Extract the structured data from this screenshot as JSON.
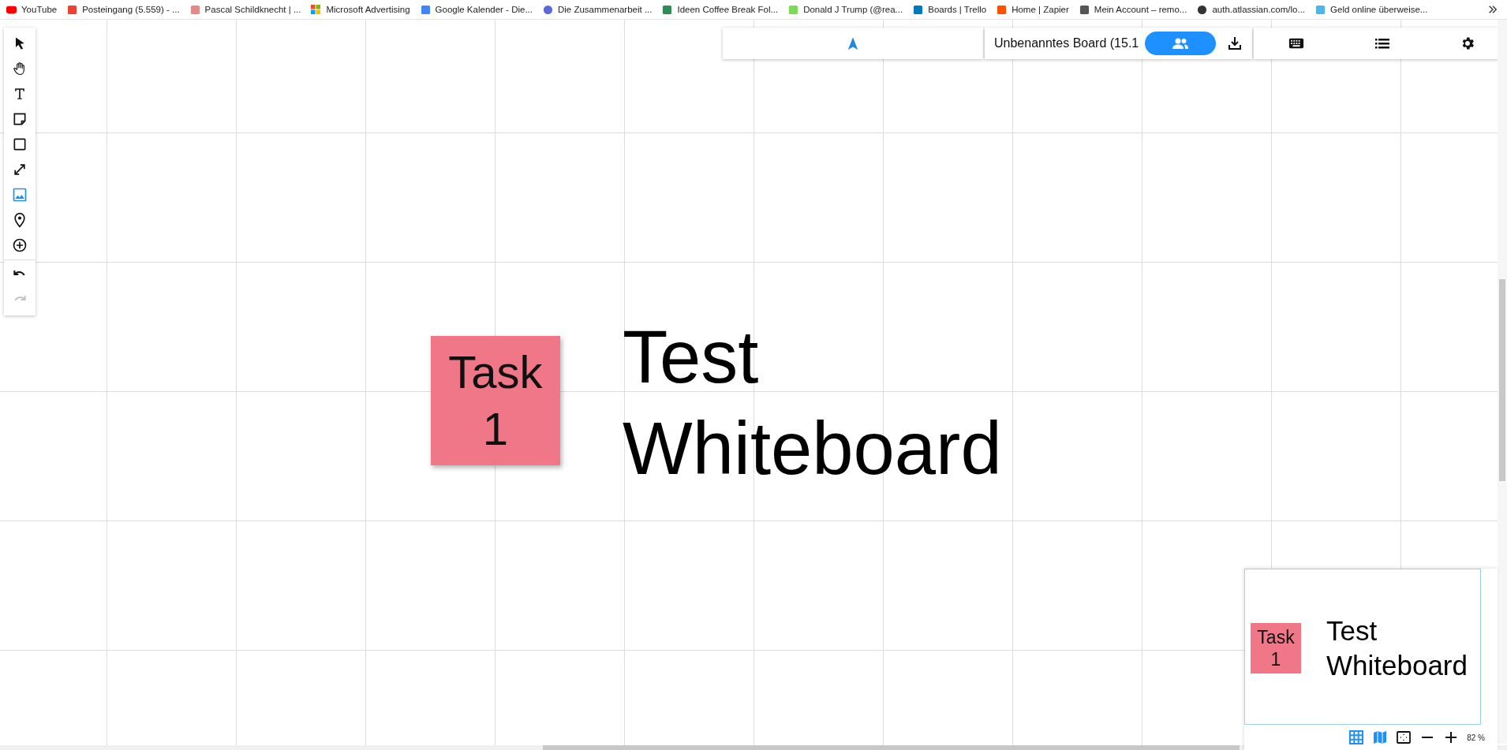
{
  "bookmarks": [
    {
      "label": "YouTube"
    },
    {
      "label": "Posteingang (5.559) - ..."
    },
    {
      "label": "Pascal Schildknecht | ..."
    },
    {
      "label": "Microsoft Advertising"
    },
    {
      "label": "Google Kalender - Die..."
    },
    {
      "label": "Die Zusammenarbeit ..."
    },
    {
      "label": "Ideen Coffee Break Fol..."
    },
    {
      "label": "Donald J Trump (@rea..."
    },
    {
      "label": "Boards | Trello"
    },
    {
      "label": "Home | Zapier"
    },
    {
      "label": "Mein Account – remo..."
    },
    {
      "label": "auth.atlassian.com/lo..."
    },
    {
      "label": "Geld online überweise..."
    }
  ],
  "tools": [
    {
      "selected": false
    },
    {
      "selected": false
    },
    {
      "selected": false
    },
    {
      "selected": false
    },
    {
      "selected": false
    },
    {
      "selected": false
    },
    {
      "selected": true
    },
    {
      "selected": false
    },
    {
      "selected": false
    }
  ],
  "history": [
    {
      "disabled": false
    },
    {
      "disabled": true
    }
  ],
  "top_toolbar": {
    "board_title": "Unbenanntes Board (15.1",
    "share_active": true
  },
  "canvas": {
    "items": [
      {
        "kind": "sticky",
        "color": "#f07787",
        "lines": [
          "Task",
          "1"
        ]
      },
      {
        "kind": "text",
        "lines": [
          "Test",
          "Whiteboard"
        ]
      }
    ]
  },
  "minimap": {
    "items": [
      {
        "kind": "sticky",
        "color": "#f07787",
        "lines": [
          "Task",
          "1"
        ]
      },
      {
        "kind": "text",
        "lines": [
          "Test",
          "Whiteboard"
        ]
      }
    ],
    "grid_on": true,
    "map_on": true,
    "zoom": "82 %"
  }
}
